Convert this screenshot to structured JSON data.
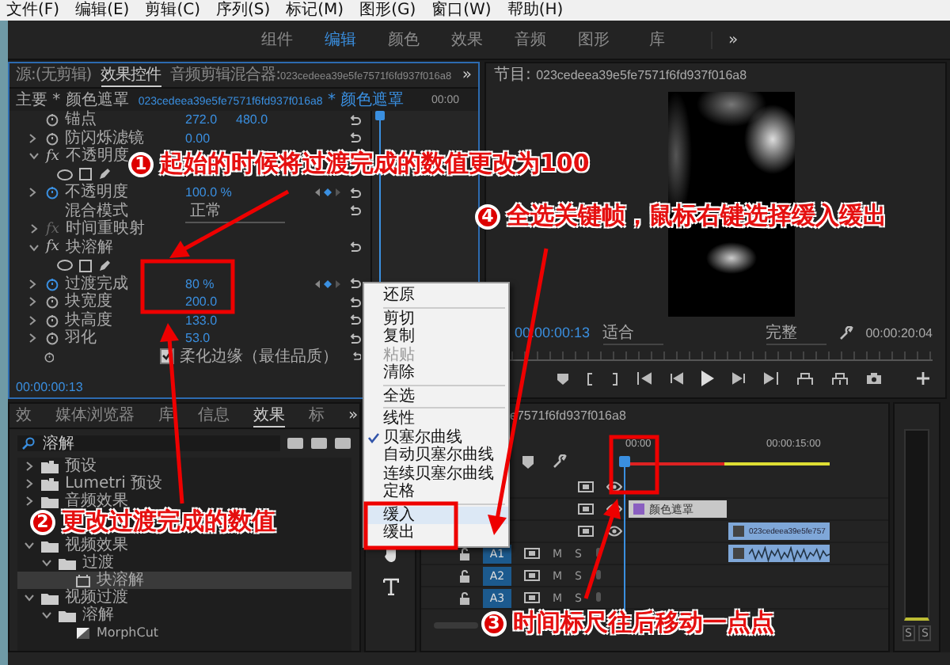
{
  "menu_bar": [
    "文件(F)",
    "编辑(E)",
    "剪辑(C)",
    "序列(S)",
    "标记(M)",
    "图形(G)",
    "窗口(W)",
    "帮助(H)"
  ],
  "workspaces": {
    "items": [
      {
        "label": "组件",
        "selected": false
      },
      {
        "label": "编辑",
        "selected": true
      },
      {
        "label": "颜色",
        "selected": false
      },
      {
        "label": "效果",
        "selected": false
      },
      {
        "label": "音频",
        "selected": false
      },
      {
        "label": "图形",
        "selected": false
      },
      {
        "label": "库",
        "selected": false
      }
    ],
    "overflow": "»"
  },
  "effect_controls": {
    "tabs": [
      {
        "label": "源:(无剪辑)",
        "selected": false
      },
      {
        "label": "效果控件",
        "selected": true
      },
      {
        "label": "音频剪辑混合器:",
        "clip": "023cedeea39e5fe7571f6fd937f016a8",
        "selected": false
      }
    ],
    "overflow": "»",
    "master": "主要 * 颜色遮罩",
    "clip": {
      "id": "023cedeea39e5fe7571f6fd937f016a8",
      "name": "* 颜色遮罩"
    },
    "ruler_time": "00:00",
    "rows": [
      {
        "kind": "property",
        "label": "锚点",
        "values": [
          "272.0",
          "480.0"
        ],
        "expandable": false,
        "animated": false,
        "keyframe_nav": false
      },
      {
        "kind": "property",
        "label": "防闪烁滤镜",
        "values": [
          "0.00"
        ],
        "expandable": true,
        "animated": false,
        "keyframe_nav": false
      },
      {
        "kind": "section",
        "badge": "fx",
        "label": "不透明度",
        "expanded": true,
        "reset": false
      },
      {
        "kind": "masks"
      },
      {
        "kind": "property",
        "label": "不透明度",
        "values": [
          "100.0 %"
        ],
        "expandable": true,
        "animated": true,
        "keyframe_nav": true
      },
      {
        "kind": "dropdown",
        "label": "混合模式",
        "value": "正常"
      },
      {
        "kind": "section",
        "badge": "fx",
        "label": "时间重映射",
        "expanded": false,
        "reset": false
      },
      {
        "kind": "section",
        "badge": "fx",
        "label": "块溶解",
        "expanded": true,
        "reset": true
      },
      {
        "kind": "masks"
      },
      {
        "kind": "property",
        "label": "过渡完成",
        "values": [
          "80 %"
        ],
        "expandable": true,
        "animated": true,
        "keyframe_nav": true
      },
      {
        "kind": "property",
        "label": "块宽度",
        "values": [
          "200.0"
        ],
        "expandable": true,
        "animated": false,
        "keyframe_nav": false
      },
      {
        "kind": "property",
        "label": "块高度",
        "values": [
          "133.0"
        ],
        "expandable": true,
        "animated": false,
        "keyframe_nav": false
      },
      {
        "kind": "property",
        "label": "羽化",
        "values": [
          "53.0"
        ],
        "expandable": true,
        "animated": false,
        "keyframe_nav": false
      },
      {
        "kind": "checkbox",
        "label": "柔化边缘（最佳品质）",
        "checked": true
      }
    ],
    "timecode": "00:00:00:13"
  },
  "program_monitor": {
    "title": {
      "label": "节目:",
      "clip": "023cedeea39e5fe7571f6fd937f016a8"
    },
    "timecode": "00:00:00:13",
    "fit": "适合",
    "quality": "完整",
    "duration": "00:00:20:04"
  },
  "effects_panel": {
    "tabs": [
      {
        "label": "效",
        "selected": false
      },
      {
        "label": "媒体浏览器",
        "selected": false
      },
      {
        "label": "库",
        "selected": false
      },
      {
        "label": "信息",
        "selected": false
      },
      {
        "label": "效果",
        "selected": true
      },
      {
        "label": "标",
        "selected": false
      }
    ],
    "overflow": "»",
    "search": "溶解",
    "tree": [
      {
        "label": "预设",
        "kind": "preset",
        "expanded": false,
        "selected": false
      },
      {
        "label": "Lumetri 预设",
        "kind": "preset",
        "expanded": false,
        "selected": false
      },
      {
        "label": "音频效果",
        "kind": "folder",
        "expanded": false,
        "selected": false
      },
      {
        "label": "视频效果",
        "kind": "folder",
        "expanded": true,
        "selected": false,
        "children": [
          {
            "label": "过渡",
            "kind": "folder",
            "expanded": true,
            "selected": false,
            "children": [
              {
                "label": "块溶解",
                "kind": "effect",
                "selected": true
              }
            ]
          }
        ]
      },
      {
        "label": "视频过渡",
        "kind": "folder",
        "expanded": true,
        "selected": false,
        "children": [
          {
            "label": "溶解",
            "kind": "folder",
            "expanded": true,
            "selected": false,
            "children": [
              {
                "label": "MorphCut",
                "kind": "transition",
                "selected": false
              }
            ]
          }
        ]
      }
    ]
  },
  "timeline": {
    "title": "e7571f6fd937f016a8",
    "ruler": [
      "00:00",
      "00:00:15:00"
    ],
    "tracks": [
      {
        "kind": "video"
      },
      {
        "kind": "video"
      },
      {
        "kind": "video"
      },
      {
        "kind": "audio",
        "label": "A1",
        "mute": "M",
        "solo": "S"
      },
      {
        "kind": "audio",
        "label": "A2",
        "mute": "M",
        "solo": "S"
      },
      {
        "kind": "audio",
        "label": "A3",
        "mute": "M",
        "solo": "S"
      }
    ],
    "clips": [
      {
        "kind": "graphic",
        "label": "颜色遮罩"
      },
      {
        "kind": "video",
        "label": "023cedeea39e5fe757"
      },
      {
        "kind": "audio"
      }
    ]
  },
  "audio_meter": [
    "S",
    "S"
  ],
  "context_menu": [
    {
      "label": "还原",
      "kind": "item",
      "checked": false,
      "disabled": false,
      "highlighted": false
    },
    {
      "kind": "separator"
    },
    {
      "label": "剪切",
      "kind": "item",
      "checked": false,
      "disabled": false,
      "highlighted": false
    },
    {
      "label": "复制",
      "kind": "item",
      "checked": false,
      "disabled": false,
      "highlighted": false
    },
    {
      "label": "粘贴",
      "kind": "item",
      "checked": false,
      "disabled": true,
      "highlighted": false
    },
    {
      "label": "清除",
      "kind": "item",
      "checked": false,
      "disabled": false,
      "highlighted": false
    },
    {
      "kind": "separator"
    },
    {
      "label": "全选",
      "kind": "item",
      "checked": false,
      "disabled": false,
      "highlighted": false
    },
    {
      "kind": "separator"
    },
    {
      "label": "线性",
      "kind": "item",
      "checked": false,
      "disabled": false,
      "highlighted": false
    },
    {
      "label": "贝塞尔曲线",
      "kind": "item",
      "checked": true,
      "disabled": false,
      "highlighted": false
    },
    {
      "label": "自动贝塞尔曲线",
      "kind": "item",
      "checked": false,
      "disabled": false,
      "highlighted": false
    },
    {
      "label": "连续贝塞尔曲线",
      "kind": "item",
      "checked": false,
      "disabled": false,
      "highlighted": false
    },
    {
      "label": "定格",
      "kind": "item",
      "checked": false,
      "disabled": false,
      "highlighted": false
    },
    {
      "kind": "separator"
    },
    {
      "label": "缓入",
      "kind": "item",
      "checked": false,
      "disabled": false,
      "highlighted": true
    },
    {
      "label": "缓出",
      "kind": "item",
      "checked": false,
      "disabled": false,
      "highlighted": false
    }
  ],
  "annotations": [
    {
      "number": "1",
      "text": "起始的时候将过渡完成的数值更改为100"
    },
    {
      "number": "4",
      "text": "全选关键帧，鼠标右键选择缓入缓出"
    },
    {
      "number": "2",
      "text": "更改过渡完成的数值"
    },
    {
      "number": "3",
      "text": "时间标尺往后移动一点点"
    }
  ]
}
